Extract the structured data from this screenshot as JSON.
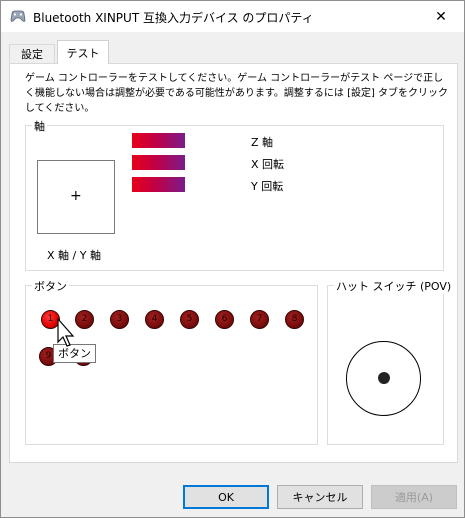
{
  "window": {
    "title": "Bluetooth XINPUT 互換入力デバイス のプロパティ",
    "close_glyph": "✕"
  },
  "tabs": [
    {
      "label": "設定",
      "selected": false
    },
    {
      "label": "テスト",
      "selected": true
    }
  ],
  "description": "ゲーム コントローラーをテストしてください。ゲーム コントローラーがテスト ページで正しく機能しない場合は調整が必要である可能性があります。調整するには [設定] タブをクリックしてください。",
  "axes_group": {
    "label": "軸",
    "xy_label": "X 軸 / Y 軸",
    "xy_crosshair": "+",
    "bars": [
      {
        "label": "Z 軸",
        "level": 1.0
      },
      {
        "label": "X 回転",
        "level": 1.0
      },
      {
        "label": "Y 回転",
        "level": 1.0
      }
    ]
  },
  "buttons_group": {
    "label": "ボタン",
    "buttons": [
      {
        "number": "1",
        "pressed": true
      },
      {
        "number": "2",
        "pressed": false
      },
      {
        "number": "3",
        "pressed": false
      },
      {
        "number": "4",
        "pressed": false
      },
      {
        "number": "5",
        "pressed": false
      },
      {
        "number": "6",
        "pressed": false
      },
      {
        "number": "7",
        "pressed": false
      },
      {
        "number": "8",
        "pressed": false
      },
      {
        "number": "9",
        "pressed": false
      },
      {
        "number": "10",
        "pressed": false
      }
    ],
    "tooltip": "ボタン"
  },
  "pov_group": {
    "label": "ハット スイッチ (POV)"
  },
  "dialog_buttons": {
    "ok": "OK",
    "cancel": "キャンセル",
    "apply": "適用(A)"
  },
  "colors": {
    "accent_focus": "#0078d7",
    "axis_bar_start": "#e8001a",
    "axis_bar_end": "#7a1c8a",
    "button_pressed": "#e00000",
    "button_idle": "#7a0d0d"
  }
}
